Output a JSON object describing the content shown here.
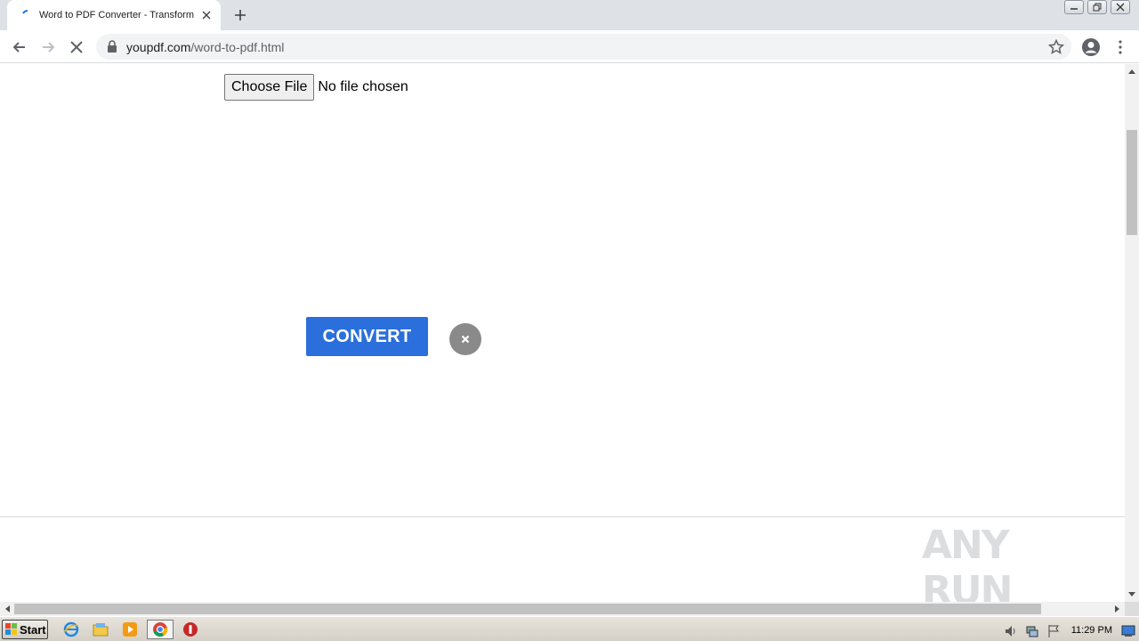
{
  "browser": {
    "tab": {
      "title": "Word to PDF Converter - Transform"
    },
    "toolbar": {
      "url_host": "youpdf.com",
      "url_path": "/word-to-pdf.html"
    }
  },
  "page": {
    "file_input": {
      "button_label": "Choose File",
      "status": "No file chosen"
    },
    "convert_label": "CONVERT",
    "cancel_symbol": "×",
    "watermark": "ANY RUN"
  },
  "taskbar": {
    "start_label": "Start",
    "clock": "11:29 PM"
  },
  "colors": {
    "convert_bg": "#2a6fdb",
    "cancel_bg": "#8a8a8a",
    "tabstrip_bg": "#dee1e6",
    "omnibox_bg": "#f1f3f4"
  }
}
